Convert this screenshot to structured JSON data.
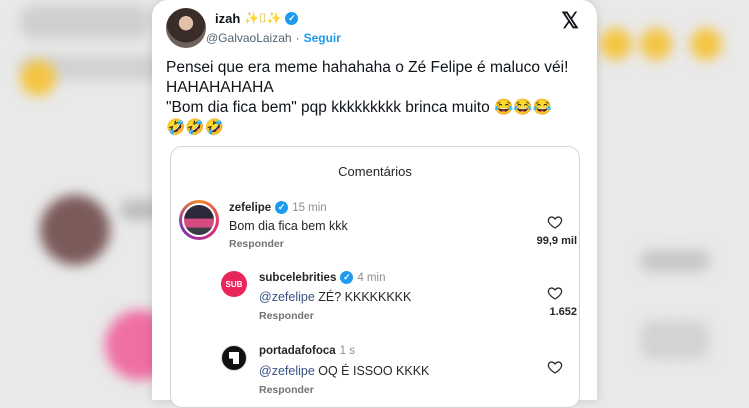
{
  "tweet": {
    "display_name": "izah",
    "sparkles": "✨⌷✨",
    "handle": "@GalvaoLaizah",
    "separator": "·",
    "follow_label": "Seguir",
    "x_logo": "𝕏",
    "text": "Pensei que era meme hahahaha o Zé Felipe é maluco véi!\nHAHAHAHAHA\n\"Bom dia fica bem\" pqp kkkkkkkkk brinca muito 😂😂😂\n🤣🤣🤣"
  },
  "embed": {
    "title": "Comentários",
    "comments": [
      {
        "username": "zefelipe",
        "verified": true,
        "time": "15 min",
        "mention": "",
        "text": "Bom dia fica bem kkk",
        "reply_label": "Responder",
        "likes": "99,9 mil"
      },
      {
        "username": "subcelebrities",
        "verified": true,
        "time": "4 min",
        "avatar_text": "SUB",
        "mention": "@zefelipe",
        "text": " ZÉ? KKKKKKKK",
        "reply_label": "Responder",
        "likes": "1.652"
      },
      {
        "username": "portadafofoca",
        "verified": false,
        "time": "1 s",
        "mention": "@zefelipe",
        "text": " OQ É ISSOO KKKK",
        "reply_label": "Responder",
        "likes": ""
      }
    ]
  },
  "colors": {
    "verified_blue": "#1d9bf0",
    "mention_blue": "#385185",
    "sub_avatar": "#e8265a"
  }
}
